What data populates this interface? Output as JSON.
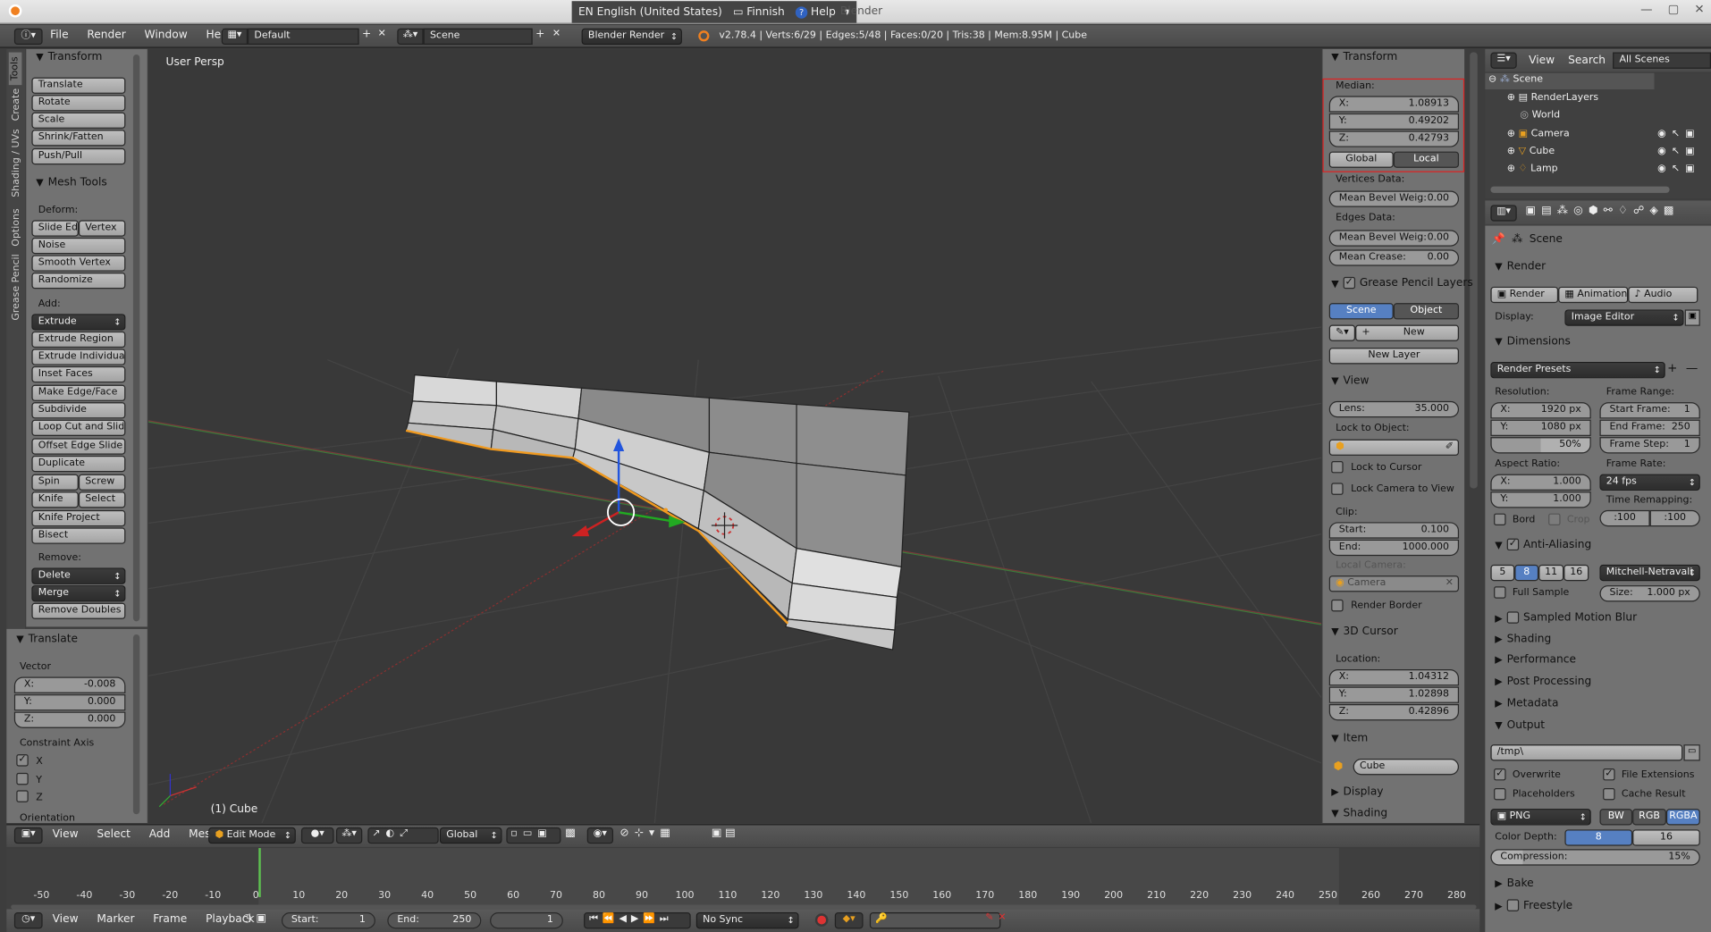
{
  "title_bar": {
    "lang": "EN English (United States)",
    "finnish": "Finnish",
    "help": "Help",
    "app": "Blender"
  },
  "top_menu": {
    "items": [
      "File",
      "Render",
      "Window",
      "Help"
    ],
    "layout": "Default",
    "scene": "Scene",
    "engine": "Blender Render",
    "stats": "v2.78.4 | Verts:6/29 | Edges:5/48 | Faces:0/20 | Tris:38 | Mem:8.95M | Cube"
  },
  "side_tabs": [
    "Tools",
    "Create",
    "Shading / UVs",
    "Options",
    "Grease Pencil"
  ],
  "tools": {
    "transform_header": "Transform",
    "transform": [
      "Translate",
      "Rotate",
      "Scale",
      "Shrink/Fatten",
      "Push/Pull"
    ],
    "mesh_header": "Mesh Tools",
    "deform_label": "Deform:",
    "slide_edge": "Slide Ed",
    "vertex": "Vertex",
    "deform": [
      "Noise",
      "Smooth Vertex",
      "Randomize"
    ],
    "add_label": "Add:",
    "extrude": "Extrude",
    "add": [
      "Extrude Region",
      "Extrude Individual",
      "Inset Faces",
      "Make Edge/Face",
      "Subdivide",
      "Loop Cut and Slide",
      "Offset Edge Slide",
      "Duplicate"
    ],
    "spin": "Spin",
    "screw": "Screw",
    "knife": "Knife",
    "select": "Select",
    "add2": [
      "Knife Project",
      "Bisect"
    ],
    "remove_label": "Remove:",
    "delete": "Delete",
    "merge": "Merge",
    "remove_doubles": "Remove Doubles"
  },
  "operator": {
    "header": "Translate",
    "vector": "Vector",
    "x_l": "X:",
    "x": "-0.008",
    "y_l": "Y:",
    "y": "0.000",
    "z_l": "Z:",
    "z": "0.000",
    "constraint": "Constraint Axis",
    "cx": "X",
    "cy": "Y",
    "cz": "Z",
    "orientation": "Orientation"
  },
  "viewport": {
    "label": "User Persp",
    "object": "(1) Cube"
  },
  "props": {
    "transform": "Transform",
    "median": "Median:",
    "mx_l": "X:",
    "mx": "1.08913",
    "my_l": "Y:",
    "my": "0.49202",
    "mz_l": "Z:",
    "mz": "0.42793",
    "global": "Global",
    "local": "Local",
    "vertices_data": "Vertices Data:",
    "mbw_l": "Mean Bevel Weig:",
    "mbw": "0.00",
    "edges_data": "Edges Data:",
    "ebw_l": "Mean Bevel Weig:",
    "ebw": "0.00",
    "crease_l": "Mean Crease:",
    "crease": "0.00",
    "gp_layers": "Grease Pencil Layers",
    "scene": "Scene",
    "object": "Object",
    "new": "New",
    "new_layer": "New Layer",
    "view": "View",
    "lens_l": "Lens:",
    "lens": "35.000",
    "lock_obj": "Lock to Object:",
    "lock_cursor": "Lock to Cursor",
    "lock_camera": "Lock Camera to View",
    "clip": "Clip:",
    "start_l": "Start:",
    "start": "0.100",
    "end_l": "End:",
    "end": "1000.000",
    "local_camera": "Local Camera:",
    "camera": "Camera",
    "render_border": "Render Border",
    "cursor": "3D Cursor",
    "location": "Location:",
    "cx_l": "X:",
    "cx": "1.04312",
    "cy_l": "Y:",
    "cy": "1.02898",
    "cz_l": "Z:",
    "cz": "0.42896",
    "item": "Item",
    "item_name": "Cube",
    "display": "Display",
    "shading": "Shading"
  },
  "outliner": {
    "view": "View",
    "search": "Search",
    "filter": "All Scenes",
    "items": [
      "Scene",
      "RenderLayers",
      "World",
      "Camera",
      "Cube",
      "Lamp"
    ]
  },
  "render_props": {
    "scene": "Scene",
    "render": "Render",
    "b_render": "Render",
    "b_animation": "Animation",
    "b_audio": "Audio",
    "display_l": "Display:",
    "display": "Image Editor",
    "dimensions": "Dimensions",
    "presets": "Render Presets",
    "resolution": "Resolution:",
    "rx_l": "X:",
    "rx": "1920 px",
    "ry_l": "Y:",
    "ry": "1080 px",
    "rpct": "50%",
    "frame_range": "Frame Range:",
    "sf_l": "Start Frame:",
    "sf": "1",
    "ef_l": "End Frame:",
    "ef": "250",
    "fs_l": "Frame Step:",
    "fs": "1",
    "aspect": "Aspect Ratio:",
    "ax_l": "X:",
    "ax": "1.000",
    "ay_l": "Y:",
    "ay": "1.000",
    "frame_rate": "Frame Rate:",
    "fps": "24 fps",
    "time_remap": "Time Remapping:",
    "tr_old": ":100",
    "tr_new": ":100",
    "bord": "Bord",
    "crop": "Crop",
    "aa": "Anti-Aliasing",
    "aa_vals": [
      "5",
      "8",
      "11",
      "16"
    ],
    "filter": "Mitchell-Netravali",
    "full_sample": "Full Sample",
    "size_l": "Size:",
    "size": "1.000 px",
    "collapsed": [
      "Sampled Motion Blur",
      "Shading",
      "Performance",
      "Post Processing",
      "Metadata"
    ],
    "output": "Output",
    "path": "/tmp\\",
    "overwrite": "Overwrite",
    "file_ext": "File Extensions",
    "placeholders": "Placeholders",
    "cache": "Cache Result",
    "format": "PNG",
    "bw": "BW",
    "rgb": "RGB",
    "rgba": "RGBA",
    "color_depth": "Color Depth:",
    "d8": "8",
    "d16": "16",
    "compression_l": "Compression:",
    "compression": "15%",
    "bake": "Bake",
    "freestyle": "Freestyle"
  },
  "view_header": {
    "items": [
      "View",
      "Select",
      "Add",
      "Mesh"
    ],
    "mode": "Edit Mode",
    "orientation": "Global"
  },
  "timeline": {
    "ticks": [
      "-50",
      "-40",
      "-30",
      "-20",
      "-10",
      "0",
      "10",
      "20",
      "30",
      "40",
      "50",
      "60",
      "70",
      "80",
      "90",
      "100",
      "110",
      "120",
      "130",
      "140",
      "150",
      "160",
      "170",
      "180",
      "190",
      "200",
      "210",
      "220",
      "230",
      "240",
      "250",
      "260",
      "270",
      "280"
    ],
    "items": [
      "View",
      "Marker",
      "Frame",
      "Playback"
    ],
    "start_l": "Start:",
    "start": "1",
    "end_l": "End:",
    "end": "250",
    "current": "1",
    "sync": "No Sync"
  }
}
